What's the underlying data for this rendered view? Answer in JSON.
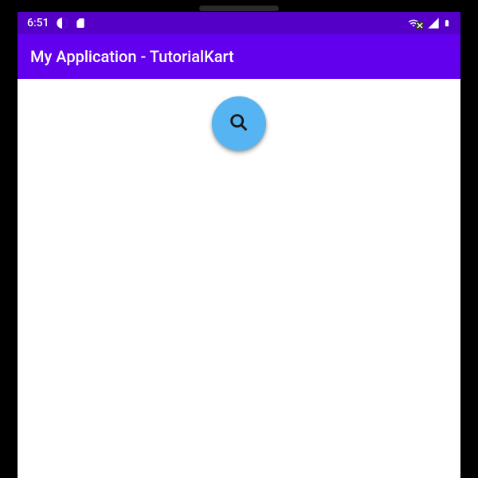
{
  "statusbar": {
    "time": "6:51"
  },
  "appbar": {
    "title": "My Application - TutorialKart"
  },
  "fab": {
    "icon": "search"
  }
}
